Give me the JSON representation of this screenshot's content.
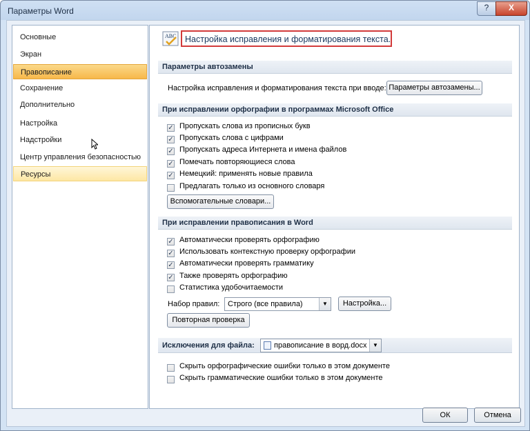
{
  "window": {
    "title": "Параметры Word",
    "help_label": "?",
    "close_label": "X"
  },
  "nav": {
    "items": [
      {
        "label": "Основные"
      },
      {
        "label": "Экран"
      },
      {
        "label": "Правописание"
      },
      {
        "label": "Сохранение"
      },
      {
        "label": "Дополнительно"
      },
      {
        "label": "Настройка"
      },
      {
        "label": "Надстройки"
      },
      {
        "label": "Центр управления безопасностью"
      },
      {
        "label": "Ресурсы"
      }
    ],
    "selected": "Правописание",
    "hovered": "Ресурсы"
  },
  "header": {
    "title": "Настройка исправления и форматирования текста.",
    "icon": "abc-spelling-icon"
  },
  "autocorrect": {
    "section_title": "Параметры автозамены",
    "description": "Настройка исправления и форматирования текста при вводе:",
    "button_label": "Параметры автозамены..."
  },
  "office_spelling": {
    "section_title": "При исправлении орфографии в программах Microsoft Office",
    "options": [
      {
        "label": "Пропускать слова из прописных букв",
        "checked": true
      },
      {
        "label": "Пропускать слова с цифрами",
        "checked": true
      },
      {
        "label": "Пропускать адреса Интернета и имена файлов",
        "checked": true
      },
      {
        "label": "Помечать повторяющиеся слова",
        "checked": true
      },
      {
        "label": "Немецкий: применять новые правила",
        "checked": true
      },
      {
        "label": "Предлагать только из основного словаря",
        "checked": false
      }
    ],
    "dictionaries_button": "Вспомогательные словари..."
  },
  "word_spelling": {
    "section_title": "При исправлении правописания в Word",
    "options": [
      {
        "label": "Автоматически проверять орфографию",
        "checked": true
      },
      {
        "label": "Использовать контекстную проверку орфографии",
        "checked": true
      },
      {
        "label": "Автоматически проверять грамматику",
        "checked": true
      },
      {
        "label": "Также проверять орфографию",
        "checked": true
      },
      {
        "label": "Статистика удобочитаемости",
        "checked": false
      }
    ],
    "ruleset_label": "Набор правил:",
    "ruleset_value": "Строго (все правила)",
    "settings_button": "Настройка...",
    "recheck_button": "Повторная проверка"
  },
  "exceptions": {
    "section_title": "Исключения для файла:",
    "file_value": "правописание в ворд.docx",
    "options": [
      {
        "label": "Скрыть орфографические ошибки только в этом документе",
        "checked": false
      },
      {
        "label": "Скрыть грамматические ошибки только в этом документе",
        "checked": false
      }
    ]
  },
  "footer": {
    "ok_label": "ОК",
    "cancel_label": "Отмена"
  },
  "colors": {
    "selected_nav": "#f7b84a",
    "hover_nav": "#fde7a4",
    "highlight_border": "#d23a3a",
    "section_header": "#dfe6ef"
  }
}
